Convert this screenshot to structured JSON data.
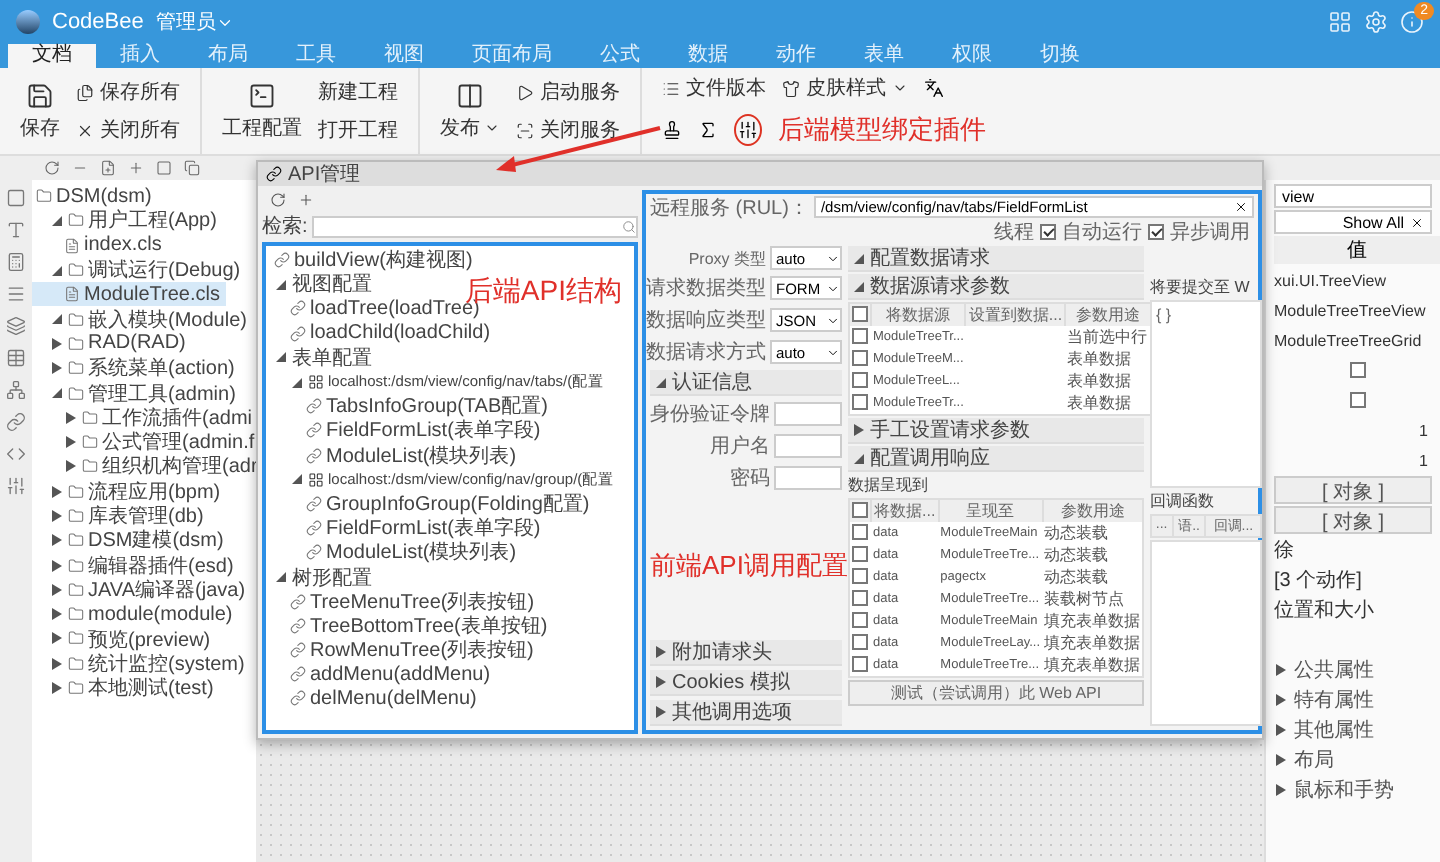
{
  "app": {
    "name": "CodeBee",
    "user": "管理员",
    "badge": "2"
  },
  "ribbon_tabs": [
    {
      "label": "文档",
      "selected": true
    },
    {
      "label": "插入",
      "selected": false
    },
    {
      "label": "布局",
      "selected": false
    },
    {
      "label": "工具",
      "selected": false
    },
    {
      "label": "视图",
      "selected": false
    },
    {
      "label": "页面布局",
      "selected": false
    },
    {
      "label": "公式",
      "selected": false
    },
    {
      "label": "数据",
      "selected": false
    },
    {
      "label": "动作",
      "selected": false
    },
    {
      "label": "表单",
      "selected": false
    },
    {
      "label": "权限",
      "selected": false
    },
    {
      "label": "切换",
      "selected": false
    }
  ],
  "ribbon": {
    "save": "保存",
    "save_all": "保存所有",
    "close_all": "关闭所有",
    "project_config": "工程配置",
    "new_project": "新建工程",
    "open_project": "打开工程",
    "publish": "发布",
    "start_service": "启动服务",
    "stop_service": "关闭服务",
    "file_version": "文件版本",
    "skin_style": "皮肤样式",
    "annotation": "后端模型绑定插件"
  },
  "project_tree": [
    {
      "label": "DSM(dsm)",
      "kind": "folder",
      "selected": false,
      "children": [
        {
          "label": "用户工程(App)",
          "kind": "folder",
          "expanded": true,
          "selected": false,
          "children": [
            {
              "label": "index.cls",
              "kind": "file",
              "selected": false
            }
          ]
        },
        {
          "label": "调试运行(Debug)",
          "kind": "folder",
          "expanded": true,
          "selected": false,
          "children": [
            {
              "label": "ModuleTree.cls",
              "kind": "file",
              "selected": true
            }
          ]
        },
        {
          "label": "嵌入模块(Module)",
          "kind": "folder",
          "expanded": true,
          "selected": false
        },
        {
          "label": "RAD(RAD)",
          "kind": "folder",
          "expanded": false,
          "selected": false
        },
        {
          "label": "系统菜单(action)",
          "kind": "folder",
          "expanded": false,
          "selected": false
        },
        {
          "label": "管理工具(admin)",
          "kind": "folder",
          "expanded": true,
          "selected": false,
          "children": [
            {
              "label": "工作流插件(admi",
              "kind": "folder",
              "expanded": false,
              "selected": false
            },
            {
              "label": "公式管理(admin.f",
              "kind": "folder",
              "expanded": false,
              "selected": false
            },
            {
              "label": "组织机构管理(adr",
              "kind": "folder",
              "expanded": false,
              "selected": false
            }
          ]
        },
        {
          "label": "流程应用(bpm)",
          "kind": "folder",
          "expanded": false,
          "selected": false
        },
        {
          "label": "库表管理(db)",
          "kind": "folder",
          "expanded": false,
          "selected": false
        },
        {
          "label": "DSM建模(dsm)",
          "kind": "folder",
          "expanded": false,
          "selected": false
        },
        {
          "label": "编辑器插件(esd)",
          "kind": "folder",
          "expanded": false,
          "selected": false
        },
        {
          "label": "JAVA编译器(java)",
          "kind": "folder",
          "expanded": false,
          "selected": false
        },
        {
          "label": "module(module)",
          "kind": "folder",
          "expanded": false,
          "selected": false
        },
        {
          "label": "预览(preview)",
          "kind": "folder",
          "expanded": false,
          "selected": false
        },
        {
          "label": "统计监控(system)",
          "kind": "folder",
          "expanded": false,
          "selected": false
        },
        {
          "label": "本地测试(test)",
          "kind": "folder",
          "expanded": false,
          "selected": false
        }
      ]
    }
  ],
  "api_dialog": {
    "title": "API管理",
    "search_label": "检索:",
    "annotation": "后端API结构",
    "tree": [
      {
        "label": "buildView(构建视图)",
        "kind": "api",
        "selected": false
      },
      {
        "label": "视图配置",
        "kind": "group",
        "expanded": true,
        "selected": false,
        "children": [
          {
            "label": "loadTree(loadTree)",
            "kind": "api",
            "selected": false
          },
          {
            "label": "loadChild(loadChild)",
            "kind": "api",
            "selected": false
          }
        ]
      },
      {
        "label": "表单配置",
        "kind": "group",
        "expanded": true,
        "selected": false,
        "children": [
          {
            "label": "localhost:/dsm/view/config/nav/tabs/(配置",
            "kind": "url",
            "expanded": true,
            "selected": false,
            "children": [
              {
                "label": "TabsInfoGroup(TAB配置)",
                "kind": "api",
                "selected": false
              },
              {
                "label": "FieldFormList(表单字段)",
                "kind": "api",
                "selected": false
              },
              {
                "label": "ModuleList(模块列表)",
                "kind": "api",
                "selected": false
              }
            ]
          },
          {
            "label": "localhost:/dsm/view/config/nav/group/(配置",
            "kind": "url",
            "expanded": true,
            "selected": false,
            "children": [
              {
                "label": "GroupInfoGroup(Folding配置)",
                "kind": "api",
                "selected": false
              },
              {
                "label": "FieldFormList(表单字段)",
                "kind": "api",
                "selected": false
              },
              {
                "label": "ModuleList(模块列表)",
                "kind": "api",
                "selected": false
              }
            ]
          }
        ]
      },
      {
        "label": "树形配置",
        "kind": "group",
        "expanded": true,
        "selected": false,
        "children": [
          {
            "label": "TreeMenuTree(列表按钮)",
            "kind": "api",
            "selected": false
          },
          {
            "label": "TreeBottomTree(表单按钮)",
            "kind": "api",
            "selected": false
          },
          {
            "label": "RowMenuTree(列表按钮)",
            "kind": "api",
            "selected": false
          },
          {
            "label": "addMenu(addMenu)",
            "kind": "api",
            "selected": false
          },
          {
            "label": "delMenu(delMenu)",
            "kind": "api",
            "selected": false
          }
        ]
      }
    ]
  },
  "api_config": {
    "url_label": "远程服务 (RUL)：",
    "url": "/dsm/view/config/nav/tabs/FieldFormList",
    "thread_label": "线程",
    "options": [
      {
        "label": "自动运行",
        "checked": true
      },
      {
        "label": "异步调用",
        "checked": true
      }
    ],
    "settings": [
      {
        "label": "Proxy 类型",
        "value": "auto"
      },
      {
        "label": "请求数据类型",
        "value": "FORM"
      },
      {
        "label": "数据响应类型",
        "value": "JSON"
      },
      {
        "label": "数据请求方式",
        "value": "auto"
      }
    ],
    "auth": {
      "title": "认证信息",
      "expanded": true,
      "fields": [
        "身份验证令牌",
        "用户名",
        "密码"
      ]
    },
    "annotation": "前端API调用配置",
    "extra_sections": [
      {
        "title": "附加请求头",
        "expanded": false
      },
      {
        "title": "Cookies 模拟",
        "expanded": false
      },
      {
        "title": "其他调用选项",
        "expanded": false
      }
    ],
    "request": {
      "title": "配置数据请求",
      "expanded": true,
      "params_title": "数据源请求参数",
      "params_expanded": true,
      "header_checked": false,
      "columns": [
        "将数据源",
        "设置到数据...",
        "参数用途"
      ],
      "rows": [
        {
          "checked": false,
          "cells": [
            "ModuleTreeTr...",
            "",
            "当前选中行"
          ]
        },
        {
          "checked": false,
          "cells": [
            "ModuleTreeM...",
            "",
            "表单数据"
          ]
        },
        {
          "checked": false,
          "cells": [
            "ModuleTreeL...",
            "",
            "表单数据"
          ]
        },
        {
          "checked": false,
          "cells": [
            "ModuleTreeTr...",
            "",
            "表单数据"
          ]
        }
      ],
      "manual_title": "手工设置请求参数",
      "manual_expanded": false
    },
    "submit": {
      "title": "将要提交至 W",
      "value": "{ }"
    },
    "response": {
      "title": "配置调用响应",
      "expanded": true,
      "present_title": "数据呈现到",
      "header_checked": false,
      "columns": [
        "将数据...",
        "呈现至",
        "参数用途"
      ],
      "rows": [
        {
          "checked": false,
          "cells": [
            "data",
            "ModuleTreeMain",
            "动态装载"
          ]
        },
        {
          "checked": false,
          "cells": [
            "data",
            "ModuleTreeTre...",
            "动态装载"
          ]
        },
        {
          "checked": false,
          "cells": [
            "data",
            "pagectx",
            "动态装载"
          ]
        },
        {
          "checked": false,
          "cells": [
            "data",
            "ModuleTreeTre...",
            "装载树节点"
          ]
        },
        {
          "checked": false,
          "cells": [
            "data",
            "ModuleTreeMain",
            "填充表单数据"
          ]
        },
        {
          "checked": false,
          "cells": [
            "data",
            "ModuleTreeLay...",
            "填充表单数据"
          ]
        },
        {
          "checked": false,
          "cells": [
            "data",
            "ModuleTreeTre...",
            "填充表单数据"
          ]
        }
      ],
      "callback_title": "回调函数",
      "callback_columns": [
        "...",
        "语..",
        "回调..."
      ]
    },
    "test_button": "测试（尝试调用）此 Web API"
  },
  "properties": {
    "target": "view",
    "filter": "Show All",
    "value_header": "值",
    "rows": [
      {
        "kind": "text",
        "value": "xui.UI.TreeView"
      },
      {
        "kind": "text",
        "value": "ModuleTreeTreeView"
      },
      {
        "kind": "text",
        "value": "ModuleTreeTreeGrid"
      },
      {
        "kind": "check",
        "checked": false
      },
      {
        "kind": "check",
        "checked": false
      },
      {
        "kind": "number",
        "value": "1"
      },
      {
        "kind": "number",
        "value": "1"
      },
      {
        "kind": "object",
        "value": "[ 对象 ]"
      },
      {
        "kind": "object",
        "value": "[ 对象 ]"
      },
      {
        "kind": "text",
        "value": "徐"
      },
      {
        "kind": "text",
        "value": "[3 个动作]"
      },
      {
        "kind": "text",
        "value": "位置和大小"
      }
    ],
    "sections": [
      {
        "title": "公共属性",
        "expanded": false
      },
      {
        "title": "特有属性",
        "expanded": false
      },
      {
        "title": "其他属性",
        "expanded": false
      },
      {
        "title": "布局",
        "expanded": false
      },
      {
        "title": "鼠标和手势",
        "expanded": false
      }
    ]
  }
}
